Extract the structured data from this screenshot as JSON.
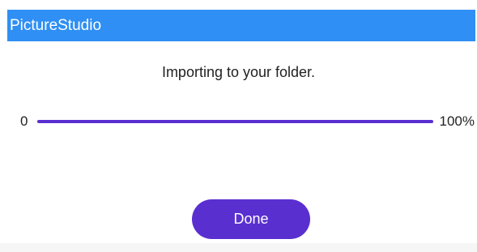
{
  "app": {
    "title": "PictureStudio"
  },
  "dialog": {
    "message": "Importing to your folder."
  },
  "progress": {
    "start_label": "0",
    "end_label": "100%",
    "value_fraction": 1.0
  },
  "actions": {
    "done_label": "Done"
  },
  "colors": {
    "titlebar": "#2f8ff4",
    "accent": "#5a2fd0"
  }
}
